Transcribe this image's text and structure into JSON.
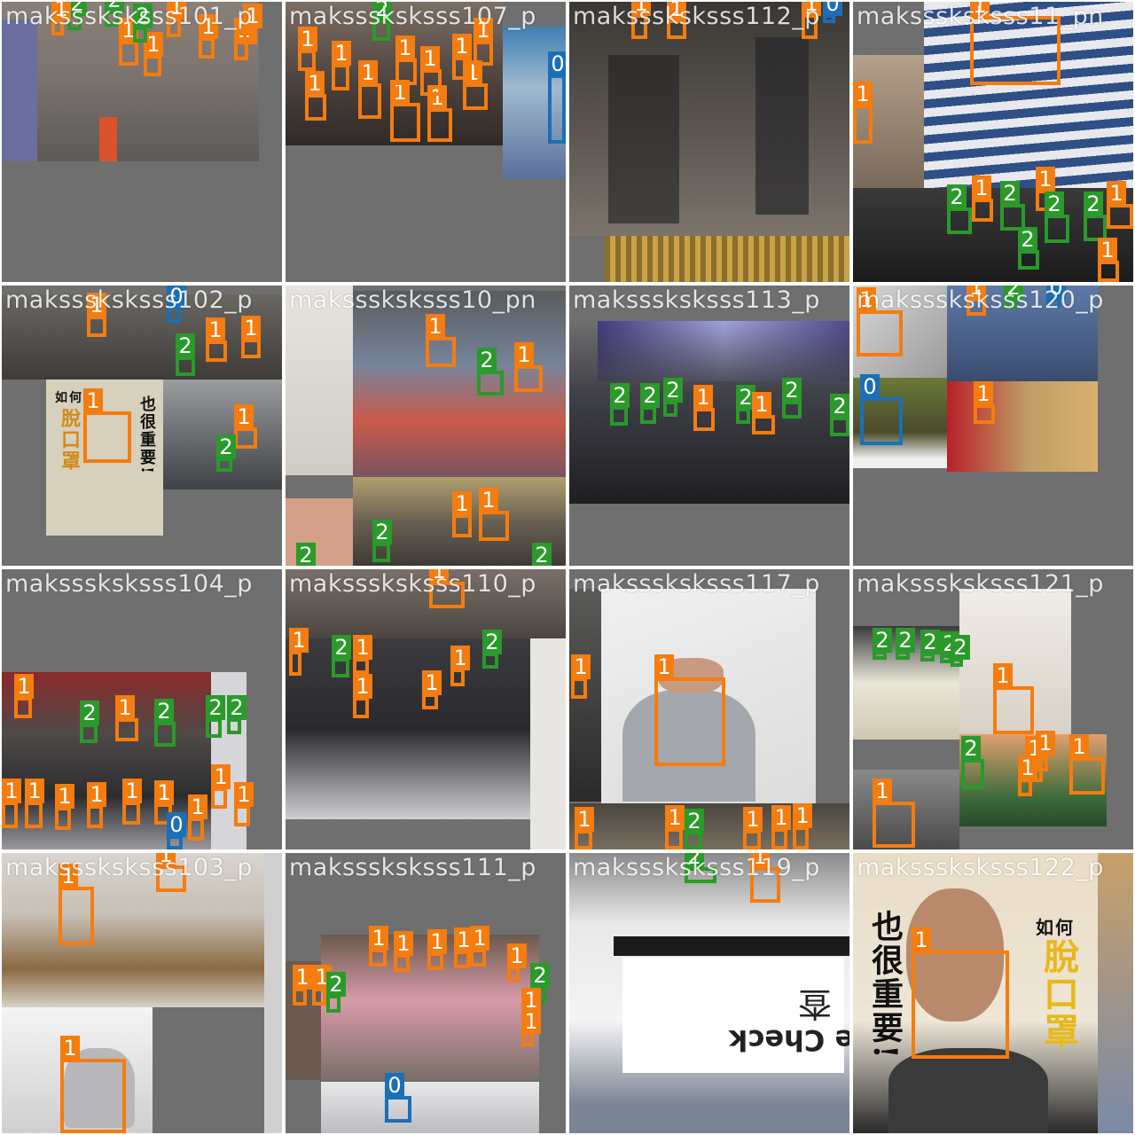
{
  "colors": {
    "class_0": "#1c6fb6",
    "class_1": "#f57c0f",
    "class_2": "#2a9a2a",
    "pad": "#6f6f6f"
  },
  "labels": {
    "c0": "0",
    "c1": "1",
    "c2": "2"
  },
  "tiles": [
    {
      "name": "maksssksksss101_p"
    },
    {
      "name": "maksssksksss107_p"
    },
    {
      "name": "maksssksksss112_p"
    },
    {
      "name": "maksssksksss11_pn"
    },
    {
      "name": "maksssksksss102_p"
    },
    {
      "name": "maksssksksss10_pn"
    },
    {
      "name": "maksssksksss113_p"
    },
    {
      "name": "maksssksksss120_p"
    },
    {
      "name": "maksssksksss104_p"
    },
    {
      "name": "maksssksksss110_p"
    },
    {
      "name": "maksssksksss117_p"
    },
    {
      "name": "maksssksksss121_p"
    },
    {
      "name": "maksssksksss103_p"
    },
    {
      "name": "maksssksksss111_p"
    },
    {
      "name": "maksssksksss119_p"
    },
    {
      "name": "maksssksksss122_p"
    }
  ],
  "poster": {
    "how_to": "如何",
    "take_off": "脫口罩",
    "also_important": "也很重要!",
    "check_sign": "e Check",
    "check_char": "查"
  }
}
